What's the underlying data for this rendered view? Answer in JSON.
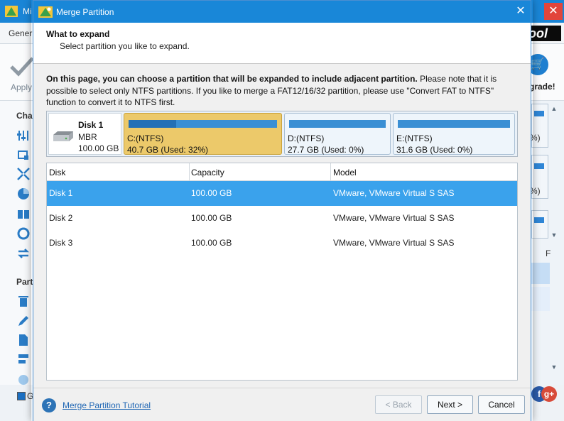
{
  "background_app": {
    "title_fragment": "Mi",
    "menu_general": "Gener",
    "brand_fragment": "ool",
    "apply_label": "Apply",
    "upgrade_label": "grade!",
    "sidebar_heading_1": "Cha",
    "sidebar_heading_2": "Part",
    "right_pct_1": "%)",
    "right_pct_2": "%)",
    "column_fragment": "F",
    "status_checkbox_label": "G",
    "window_controls": {
      "minimize": "–",
      "maximize": "□",
      "close": "✕"
    }
  },
  "dialog": {
    "title": "Merge Partition",
    "close_symbol": "✕",
    "header": {
      "title": "What to expand",
      "subtitle": "Select partition you like to expand."
    },
    "description_bold": "On this page, you can choose a partition that will be expanded to include adjacent partition.",
    "description_rest": " Please note that it is possible to select only NTFS partitions. If you like to merge a FAT12/16/32 partition, please use \"Convert FAT to NTFS\" function to convert it to NTFS first.",
    "disk_map": {
      "disk_name": "Disk 1",
      "disk_type": "MBR",
      "disk_size": "100.00 GB",
      "partitions": [
        {
          "name": "C:(NTFS)",
          "stat": "40.7 GB (Used: 32%)",
          "used_fraction": 0.32,
          "selected": true
        },
        {
          "name": "D:(NTFS)",
          "stat": "27.7 GB (Used: 0%)",
          "used_fraction": 0.0,
          "selected": false
        },
        {
          "name": "E:(NTFS)",
          "stat": "31.6 GB (Used: 0%)",
          "used_fraction": 0.0,
          "selected": false
        }
      ]
    },
    "table": {
      "columns": [
        "Disk",
        "Capacity",
        "Model"
      ],
      "rows": [
        {
          "disk": "Disk 1",
          "capacity": "100.00 GB",
          "model": "VMware, VMware Virtual S SAS",
          "selected": true
        },
        {
          "disk": "Disk 2",
          "capacity": "100.00 GB",
          "model": "VMware, VMware Virtual S SAS",
          "selected": false
        },
        {
          "disk": "Disk 3",
          "capacity": "100.00 GB",
          "model": "VMware, VMware Virtual S SAS",
          "selected": false
        }
      ]
    },
    "footer": {
      "help_symbol": "?",
      "tutorial_link": "Merge Partition Tutorial",
      "back_label": "< Back",
      "next_label": "Next >",
      "cancel_label": "Cancel"
    }
  },
  "colors": {
    "titlebar": "#1987d8",
    "selected_partition": "#ecc96a",
    "selected_row": "#3aa2ec",
    "partition_bar": "#3a8fd4"
  }
}
